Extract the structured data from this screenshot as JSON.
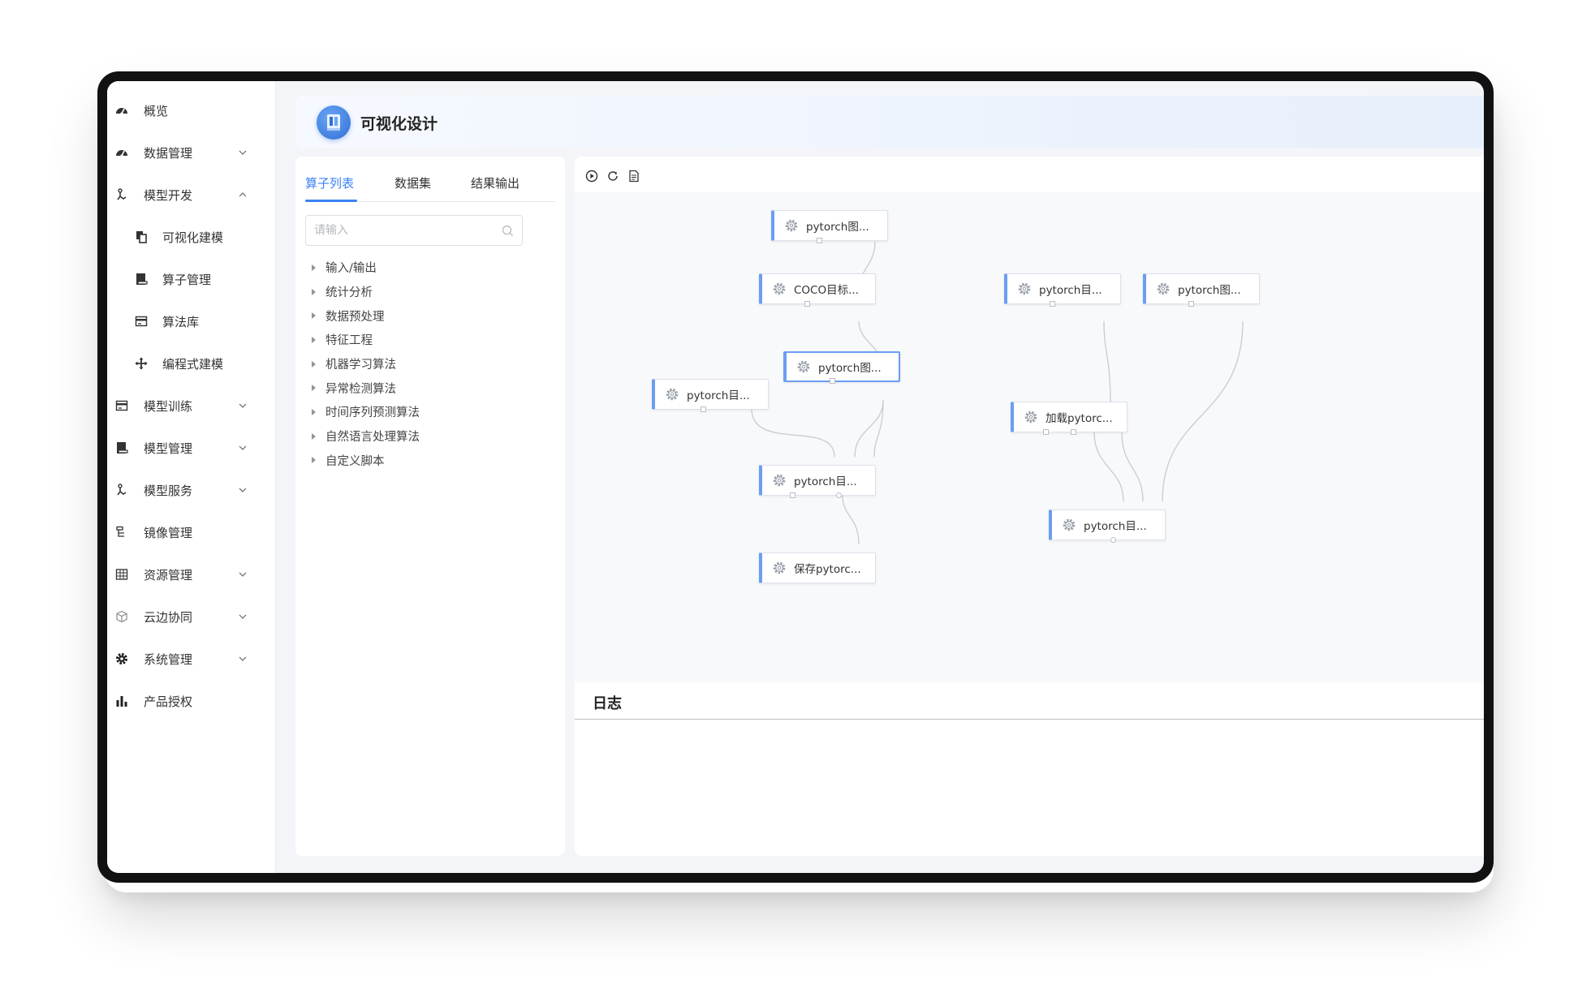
{
  "sidebar": {
    "items": [
      {
        "label": "概览",
        "icon": "dashboard-icon",
        "expandable": false
      },
      {
        "label": "数据管理",
        "icon": "dashboard-icon",
        "expandable": true,
        "expanded": false
      },
      {
        "label": "模型开发",
        "icon": "robot-hand-icon",
        "expandable": true,
        "expanded": true
      },
      {
        "label": "可视化建模",
        "icon": "copy-icon",
        "sub": true
      },
      {
        "label": "算子管理",
        "icon": "book-icon",
        "sub": true
      },
      {
        "label": "算法库",
        "icon": "card-icon",
        "sub": true
      },
      {
        "label": "编程式建模",
        "icon": "move-icon",
        "sub": true
      },
      {
        "label": "模型训练",
        "icon": "card-icon",
        "expandable": true,
        "expanded": false
      },
      {
        "label": "模型管理",
        "icon": "book-icon",
        "expandable": true,
        "expanded": false
      },
      {
        "label": "模型服务",
        "icon": "robot-hand-icon",
        "expandable": true,
        "expanded": false
      },
      {
        "label": "镜像管理",
        "icon": "tree-icon",
        "expandable": false
      },
      {
        "label": "资源管理",
        "icon": "grid-icon",
        "expandable": true,
        "expanded": false
      },
      {
        "label": "云边协同",
        "icon": "cube-icon",
        "expandable": true,
        "expanded": false
      },
      {
        "label": "系统管理",
        "icon": "gear-icon",
        "expandable": true,
        "expanded": false
      },
      {
        "label": "产品授权",
        "icon": "bar-chart-icon",
        "expandable": false
      }
    ]
  },
  "header": {
    "title": "可视化设计"
  },
  "panel": {
    "tabs": [
      "算子列表",
      "数据集",
      "结果输出"
    ],
    "active_tab": 0,
    "search_placeholder": "请输入",
    "tree": [
      "输入/输出",
      "统计分析",
      "数据预处理",
      "特征工程",
      "机器学习算法",
      "异常检测算法",
      "时间序列预测算法",
      "自然语言处理算法",
      "自定义脚本"
    ]
  },
  "toolbar": {
    "run": "play-icon",
    "refresh": "refresh-icon",
    "document": "document-icon"
  },
  "graph": {
    "nodes": [
      {
        "id": "n1",
        "label": "pytorch图..."
      },
      {
        "id": "n2",
        "label": "COCO目标..."
      },
      {
        "id": "n3",
        "label": "pytorch图...",
        "selected": true
      },
      {
        "id": "n4",
        "label": "pytorch目..."
      },
      {
        "id": "n5",
        "label": "pytorch目..."
      },
      {
        "id": "n6",
        "label": "保存pytorc..."
      },
      {
        "id": "n7",
        "label": "pytorch目..."
      },
      {
        "id": "n8",
        "label": "pytorch图..."
      },
      {
        "id": "n9",
        "label": "加载pytorc..."
      },
      {
        "id": "n10",
        "label": "pytorch目..."
      }
    ],
    "edges": [
      [
        "n1",
        "n2"
      ],
      [
        "n2",
        "n3"
      ],
      [
        "n4",
        "n5"
      ],
      [
        "n3",
        "n5"
      ],
      [
        "n3",
        "n5"
      ],
      [
        "n5",
        "n6"
      ],
      [
        "n7",
        "n9"
      ],
      [
        "n9",
        "n10"
      ],
      [
        "n9",
        "n10"
      ],
      [
        "n8",
        "n10"
      ]
    ]
  },
  "log": {
    "title": "日志"
  },
  "colors": {
    "accent": "#3b82f6",
    "node_accent": "#6a9ef2",
    "canvas_bg": "#f8f9fb"
  }
}
